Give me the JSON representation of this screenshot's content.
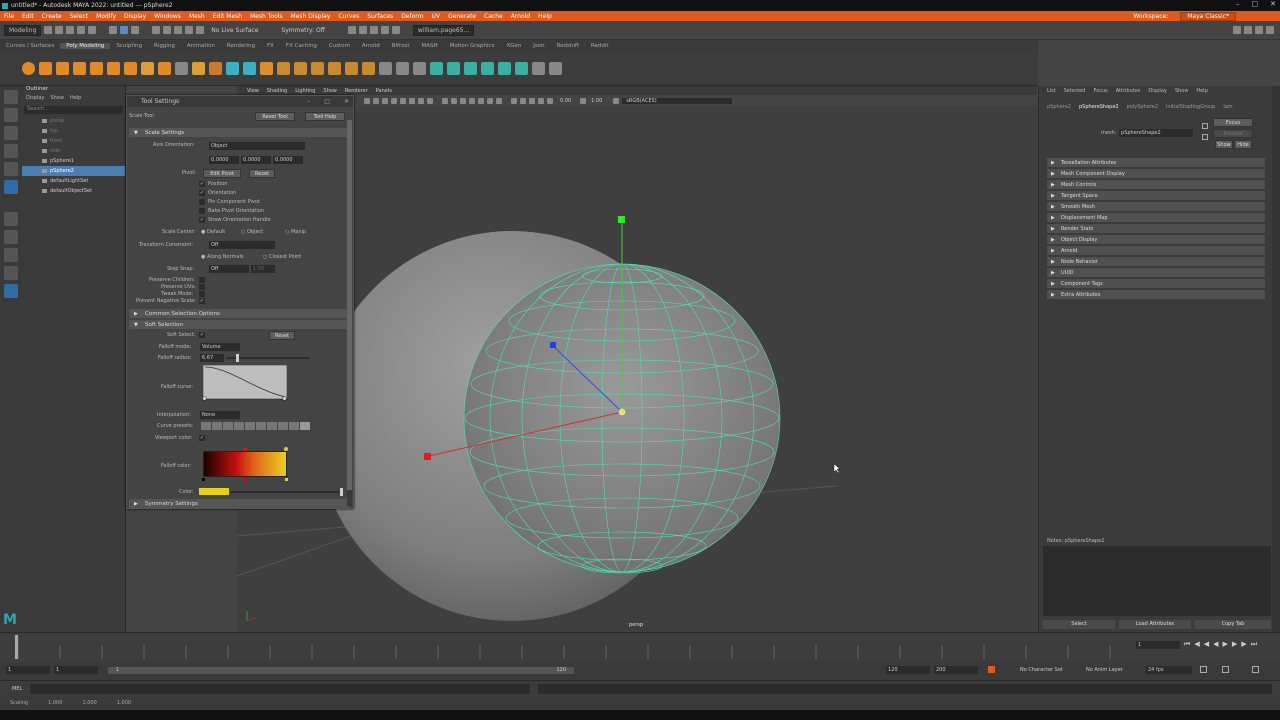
{
  "window": {
    "title": "untitled* - Autodesk MAYA 2022: untitled  ---  pSphere2"
  },
  "menubar": {
    "items": [
      "File",
      "Edit",
      "Create",
      "Select",
      "Modify",
      "Display",
      "Windows",
      "Mesh",
      "Edit Mesh",
      "Mesh Tools",
      "Mesh Display",
      "Curves",
      "Surfaces",
      "Deform",
      "UV",
      "Generate",
      "Cache",
      "Arnold",
      "Help"
    ],
    "workspace_label": "Workspace:",
    "workspace_value": "Maya Classic*"
  },
  "statusline": {
    "mode": "Modeling",
    "live_surface": "No Live Surface",
    "symmetry": "Symmetry: Off",
    "user": "william.page65..."
  },
  "shelf_tabs": [
    "Curves / Surfaces",
    "Poly Modeling",
    "Sculpting",
    "Rigging",
    "Animation",
    "Rendering",
    "FX",
    "FX Caching",
    "Custom",
    "Arnold",
    "Bifrost",
    "MASH",
    "Motion Graphics",
    "XGen",
    "Json",
    "Redshift",
    "Reddit"
  ],
  "outliner": {
    "title": "Outliner",
    "menu": [
      "Display",
      "Show",
      "Help"
    ],
    "search_placeholder": "Search...",
    "items": [
      {
        "label": "persp",
        "dim": true
      },
      {
        "label": "top",
        "dim": true
      },
      {
        "label": "front",
        "dim": true
      },
      {
        "label": "side",
        "dim": true
      },
      {
        "label": "pSphere1",
        "dim": false
      },
      {
        "label": "pSphere2",
        "dim": false,
        "selected": true
      },
      {
        "label": "defaultLightSet",
        "dim": false
      },
      {
        "label": "defaultObjectSet",
        "dim": false
      }
    ]
  },
  "tool_settings": {
    "title": "Tool Settings",
    "tool_name": "Scale Tool",
    "reset_tool": "Reset Tool",
    "tool_help": "Tool Help",
    "scale_settings": "Scale Settings",
    "axis_orientation_label": "Axis Orientation:",
    "axis_orientation_value": "Object",
    "axis_values": [
      "0.0000",
      "0.0000",
      "0.0000"
    ],
    "pivot_label": "Pivot:",
    "edit_pivot": "Edit Pivot",
    "reset": "Reset",
    "pivot_checks": [
      "Position",
      "Orientation",
      "Pin Component Pivot",
      "Bake Pivot Orientation",
      "Show Orientation Handle"
    ],
    "scale_center_label": "Scale Center:",
    "scale_center_options": [
      "Default",
      "Object",
      "Manip"
    ],
    "transform_constraint_label": "Transform Constraint:",
    "transform_constraint_value": "Off",
    "constraint_options": [
      "Along Normals",
      "Closest Point"
    ],
    "step_snap_label": "Step Snap:",
    "step_snap_value": "Off",
    "step_snap_num": "1.00",
    "preserve_children": "Preserve Children:",
    "preserve_uvs": "Preserve UVs:",
    "tweak_mode": "Tweak Mode:",
    "prevent_negative": "Prevent Negative Scale:",
    "common_selection": "Common Selection Options",
    "soft_selection": "Soft Selection",
    "soft_select_label": "Soft Select:",
    "falloff_mode_label": "Falloff mode:",
    "falloff_mode_value": "Volume",
    "falloff_radius_label": "Falloff radius:",
    "falloff_radius_value": "6.67",
    "falloff_curve_label": "Falloff curve:",
    "interpolation_label": "Interpolation:",
    "interpolation_value": "None",
    "curve_presets_label": "Curve presets:",
    "viewport_color_label": "Viewport color:",
    "falloff_color_label": "Falloff color:",
    "color_label": "Color:",
    "symmetry_settings": "Symmetry Settings"
  },
  "viewport": {
    "menu": [
      "View",
      "Shading",
      "Lighting",
      "Show",
      "Renderer",
      "Panels"
    ],
    "time_a": "0.00",
    "time_b": "1.00",
    "colorspace": "sRGB(ACES)",
    "camera_label": "persp"
  },
  "attribute_editor": {
    "menu": [
      "List",
      "Selected",
      "Focus",
      "Attributes",
      "Display",
      "Show",
      "Help"
    ],
    "tabs": [
      "pSphere2",
      "pSphereShape2",
      "polySphere2",
      "initialShadingGroup",
      "lam"
    ],
    "active_tab": "pSphereShape2",
    "mesh_label": "mesh:",
    "mesh_value": "pSphereShape2",
    "focus": "Focus",
    "presets": "Presets",
    "show": "Show",
    "hide": "Hide",
    "sections": [
      "Tessellation Attributes",
      "Mesh Component Display",
      "Mesh Controls",
      "Tangent Space",
      "Smooth Mesh",
      "Displacement Map",
      "Render Stats",
      "Object Display",
      "Arnold",
      "Node Behavior",
      "UUID",
      "Component Tags",
      "Extra Attributes"
    ],
    "notes": "Notes: pSphereShape2",
    "buttons": [
      "Select",
      "Load Attributes",
      "Copy Tab"
    ]
  },
  "timeline": {
    "current_frame": "1",
    "range_start": "1",
    "range_start2": "1",
    "range_inner_start": "1",
    "range_inner_end": "120",
    "range_end": "120",
    "range_end2": "200",
    "character_set": "No Character Set",
    "anim_layer": "No Anim Layer",
    "fps": "24 fps"
  },
  "mel": {
    "label": "MEL"
  },
  "help_line": {
    "text": "Scaling",
    "values": [
      "1.000",
      "1.000",
      "1.000"
    ]
  }
}
